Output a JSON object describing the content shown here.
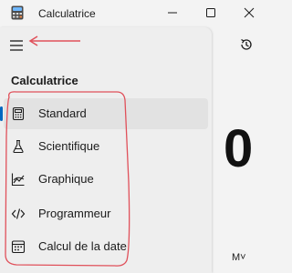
{
  "window": {
    "title": "Calculatrice",
    "minimize_icon": "minimize-icon",
    "maximize_icon": "maximize-icon",
    "close_icon": "close-icon"
  },
  "nav": {
    "menu_icon": "hamburger-menu-icon",
    "section_label": "Calculatrice",
    "items": [
      {
        "label": "Standard",
        "icon": "calculator-icon",
        "selected": true
      },
      {
        "label": "Scientifique",
        "icon": "flask-icon",
        "selected": false
      },
      {
        "label": "Graphique",
        "icon": "graph-icon",
        "selected": false
      },
      {
        "label": "Programmeur",
        "icon": "code-icon",
        "selected": false
      },
      {
        "label": "Calcul de la date",
        "icon": "calendar-icon",
        "selected": false
      }
    ]
  },
  "display": {
    "value": "0"
  },
  "memory": {
    "label": "M˅"
  },
  "colors": {
    "annotation": "#e0505a",
    "accent": "#0067c0"
  }
}
